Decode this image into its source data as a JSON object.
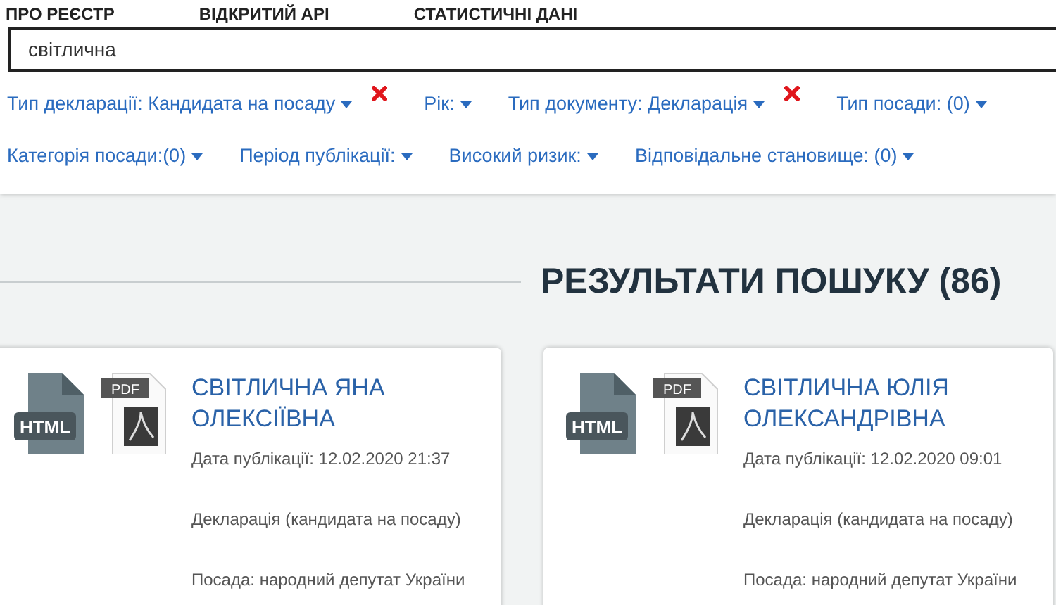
{
  "nav": [
    "ПРО РЕЄСТР",
    "ВІДКРИТИЙ API",
    "СТАТИСТИЧНІ ДАНІ"
  ],
  "search": {
    "value": "світлична"
  },
  "filter_rows": [
    [
      {
        "kind": "dropdown",
        "label": "Тип декларації: Кандидата на посаду"
      },
      {
        "kind": "remove"
      },
      {
        "kind": "dropdown",
        "label": "Рік:"
      },
      {
        "kind": "dropdown",
        "label": "Тип документу: Декларація"
      },
      {
        "kind": "remove"
      },
      {
        "kind": "dropdown",
        "label": "Тип посади: (0)"
      }
    ],
    [
      {
        "kind": "dropdown",
        "label": "Категорія посади:(0)"
      },
      {
        "kind": "dropdown",
        "label": "Період публікації:"
      },
      {
        "kind": "dropdown",
        "label": "Високий ризик:"
      },
      {
        "kind": "dropdown",
        "label": "Відповідальне становище: (0)"
      }
    ]
  ],
  "results_heading": "РЕЗУЛЬТАТИ ПОШУКУ (86)",
  "results": [
    {
      "html_label": "HTML",
      "pdf_label": "PDF",
      "name": "СВІТЛИЧНА ЯНА ОЛЕКСІЇВНА",
      "date": "Дата публікації: 12.02.2020 21:37",
      "type": "Декларація (кандидата на посаду)",
      "position": "Посада: народний депутат України"
    },
    {
      "html_label": "HTML",
      "pdf_label": "PDF",
      "name": "СВІТЛИЧНА ЮЛІЯ ОЛЕКСАНДРІВНА",
      "date": "Дата публікації: 12.02.2020 09:01",
      "type": "Декларація (кандидата на посаду)",
      "position": "Посада: народний депутат України"
    }
  ]
}
